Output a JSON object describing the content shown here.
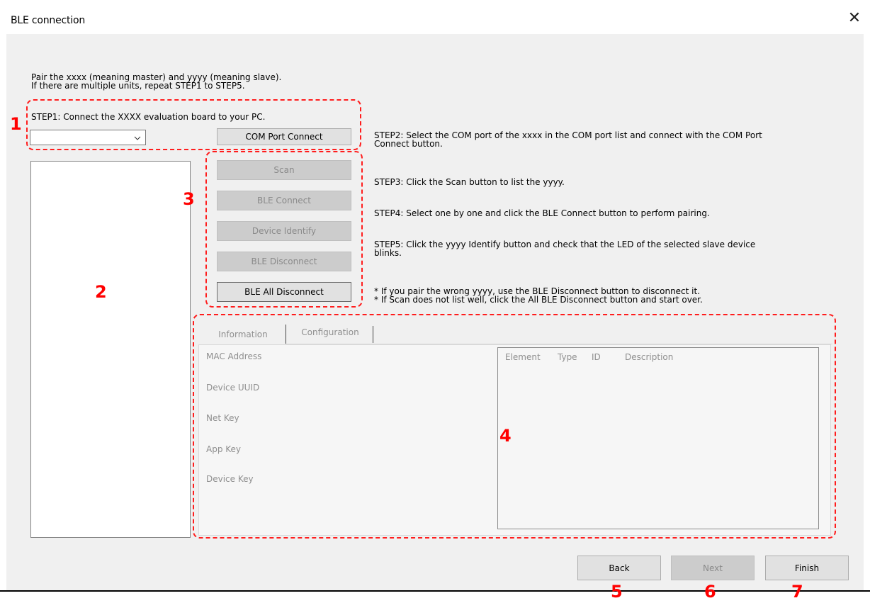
{
  "window": {
    "title": "BLE connection",
    "close_icon": "close-icon"
  },
  "intro": {
    "line1": "Pair the xxxx (meaning master) and yyyy (meaning slave).",
    "line2": "If there are multiple units, repeat STEP1 to STEP5."
  },
  "step1": {
    "text": "STEP1: Connect the XXXX evaluation board to your PC.",
    "com_select_value": "",
    "com_connect_label": "COM Port Connect"
  },
  "buttons": {
    "scan": "Scan",
    "ble_connect": "BLE Connect",
    "device_identify": "Device Identify",
    "ble_disconnect": "BLE Disconnect",
    "ble_all_disconnect": "BLE All Disconnect"
  },
  "steps": {
    "step2_line1": "STEP2: Select the COM port of the xxxx in the COM port list and connect with the COM Port",
    "step2_line2": "Connect button.",
    "step3": "STEP3: Click the Scan button to list the yyyy.",
    "step4": "STEP4: Select one by one and click the BLE Connect button to perform pairing.",
    "step5_line1": "STEP5: Click the yyyy Identify button and check that the LED of the selected slave device",
    "step5_line2": "blinks.",
    "note1": "* If you pair the wrong yyyy, use the BLE Disconnect button to disconnect it.",
    "note2": "* If Scan does not list well, click the All BLE Disconnect button and start over."
  },
  "tabs": {
    "information": "Information",
    "configuration": "Configuration"
  },
  "info_fields": {
    "mac": "MAC Address",
    "uuid": "Device UUID",
    "netkey": "Net Key",
    "appkey": "App Key",
    "devkey": "Device Key"
  },
  "element_list": {
    "columns": [
      "Element",
      "Type",
      "ID",
      "Description"
    ]
  },
  "nav": {
    "back": "Back",
    "next": "Next",
    "finish": "Finish"
  },
  "annotations": [
    "1",
    "2",
    "3",
    "4",
    "5",
    "6",
    "7"
  ],
  "colors": {
    "annotation": "#ff0000",
    "window_bg": "#f0f0f0",
    "disabled_button": "#cccccc"
  }
}
